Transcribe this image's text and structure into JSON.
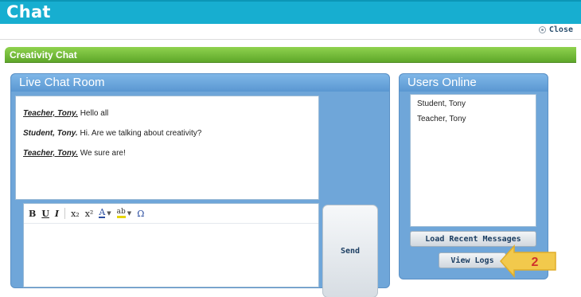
{
  "app": {
    "title": "Chat",
    "close_label": "Close"
  },
  "section": {
    "title": "Creativity Chat"
  },
  "chat_room": {
    "title": "Live Chat Room",
    "messages": [
      {
        "author": "Teacher, Tony.",
        "text": " Hello all"
      },
      {
        "author": "Student, Tony.",
        "text": " Hi. Are we talking about creativity?"
      },
      {
        "author": "Teacher, Tony.",
        "text": " We sure are!"
      }
    ],
    "toolbar": {
      "bold": "B",
      "underline": "U",
      "italic": "I",
      "subscript": "x₂",
      "superscript": "x²",
      "font_color": "A",
      "highlight": "ab",
      "special_char": "Ω"
    },
    "send_label": "Send"
  },
  "users_online": {
    "title": "Users Online",
    "users": [
      "Student, Tony",
      "Teacher, Tony"
    ],
    "load_recent_label": "Load Recent Messages",
    "view_logs_label": "View Logs"
  },
  "callout": {
    "number": "2",
    "color": "#f2c94c"
  }
}
